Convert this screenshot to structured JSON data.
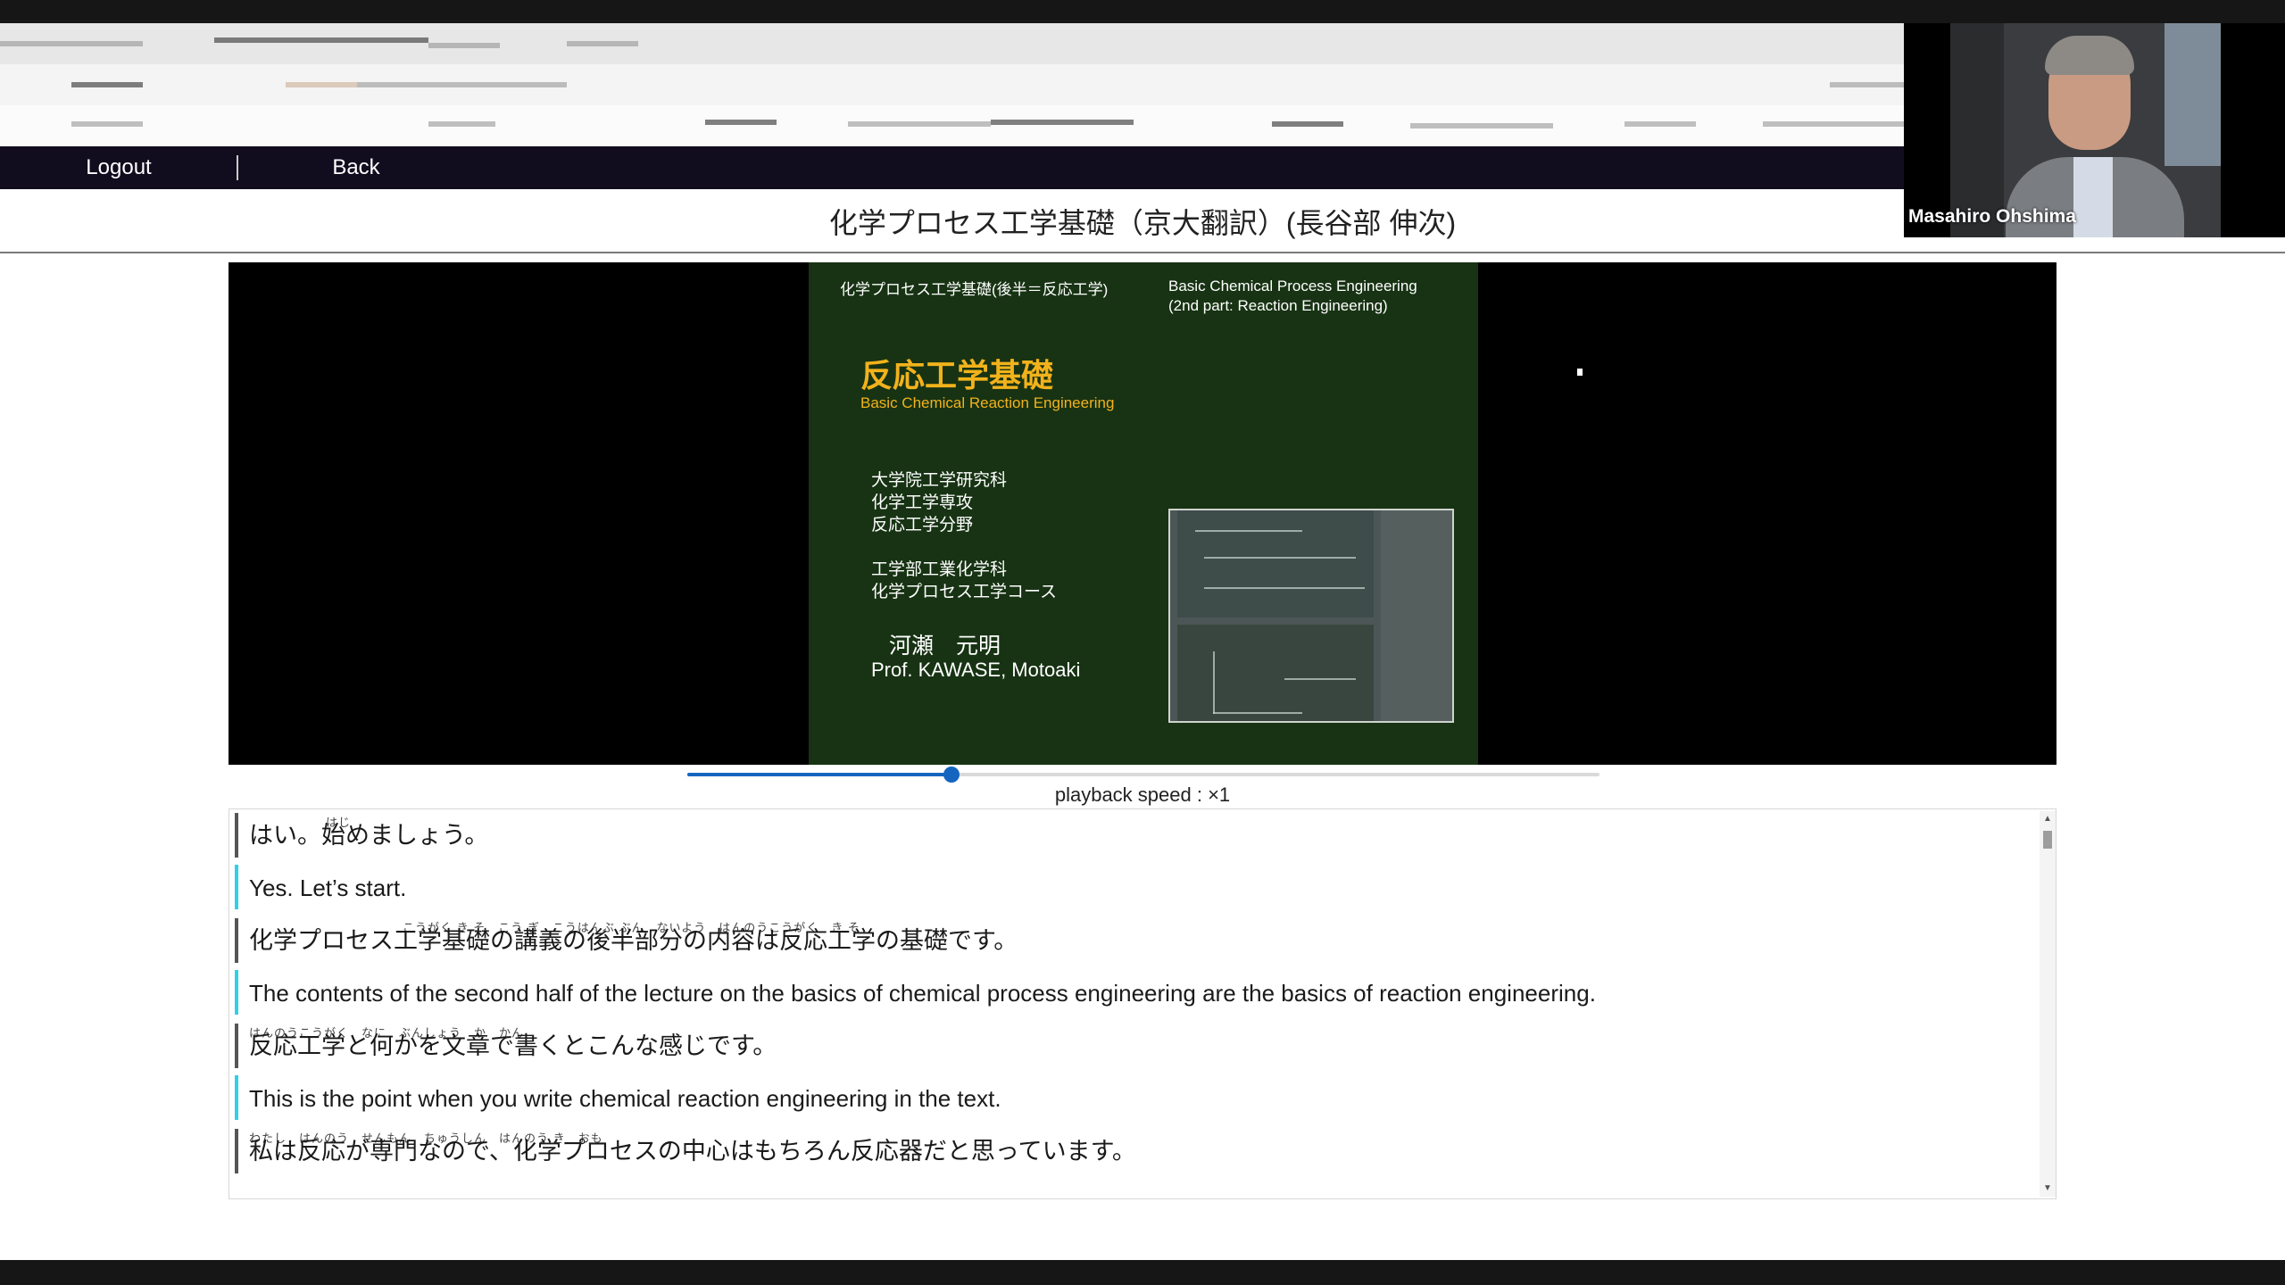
{
  "nav": {
    "logout_label": "Logout",
    "back_label": "Back"
  },
  "webcam": {
    "participant_name": "Masahiro Ohshima"
  },
  "page": {
    "title": "化学プロセス工学基礎（京大翻訳）(長谷部 伸次)"
  },
  "slide": {
    "header_jp": "化学プロセス工学基礎(後半＝反応工学)",
    "header_en_line1": "Basic Chemical Process Engineering",
    "header_en_line2": "(2nd part: Reaction Engineering)",
    "title_jp": "反応工学基礎",
    "title_en": "Basic Chemical Reaction Engineering",
    "dept_lines": [
      "大学院工学研究科",
      "化学工学専攻",
      "反応工学分野"
    ],
    "dept_lines2": [
      "工学部工業化学科",
      "化学プロセス工学コース"
    ],
    "professor_jp": "河瀬　元明",
    "professor_en": "Prof. KAWASE, Motoaki"
  },
  "player": {
    "progress": 0.29,
    "speed_label": "playback speed : ×1"
  },
  "transcript": {
    "lines": [
      {
        "lang": "jp",
        "text": "はい。始めましょう。",
        "ruby": "はじ"
      },
      {
        "lang": "en",
        "text": "Yes. Let’s start."
      },
      {
        "lang": "jp",
        "text": "化学プロセス工学基礎の講義の後半部分の内容は反応工学の基礎です。",
        "ruby": "こうがく き そ　こう ぎ　こうはんぶ ぶん　ないよう　はんのうこうがく　き そ"
      },
      {
        "lang": "en",
        "text": "The contents of the second half of the lecture on the basics of chemical process engineering are the basics of reaction engineering."
      },
      {
        "lang": "jp",
        "text": "反応工学と何かを文章で書くとこんな感じです。",
        "ruby": "はんのうこうがく　なに　ぶんしょう　か　かん"
      },
      {
        "lang": "en",
        "text": "This is the point when you write chemical reaction engineering in the text."
      },
      {
        "lang": "jp",
        "text": "私は反応が専門なので、化学プロセスの中心はもちろん反応器だと思っています。",
        "ruby": "わたし　はんのう　せんもん　ちゅうしん　はんのう き　おも"
      }
    ]
  }
}
